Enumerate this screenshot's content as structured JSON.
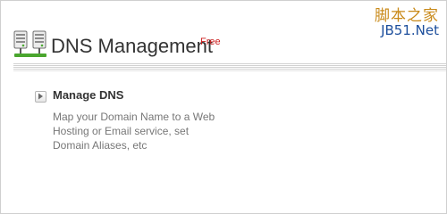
{
  "header": {
    "title": "DNS Management",
    "badge": "Free"
  },
  "watermark": {
    "line1": "脚本之家",
    "line2": "JB51.Net"
  },
  "items": [
    {
      "title": "Manage DNS",
      "description_lines": [
        "Map your Domain Name to a Web",
        "Hosting or Email service, set",
        "Domain Aliases, etc"
      ]
    }
  ],
  "icons": {
    "header": "server-network-icon",
    "item": "expand-arrow-icon"
  }
}
